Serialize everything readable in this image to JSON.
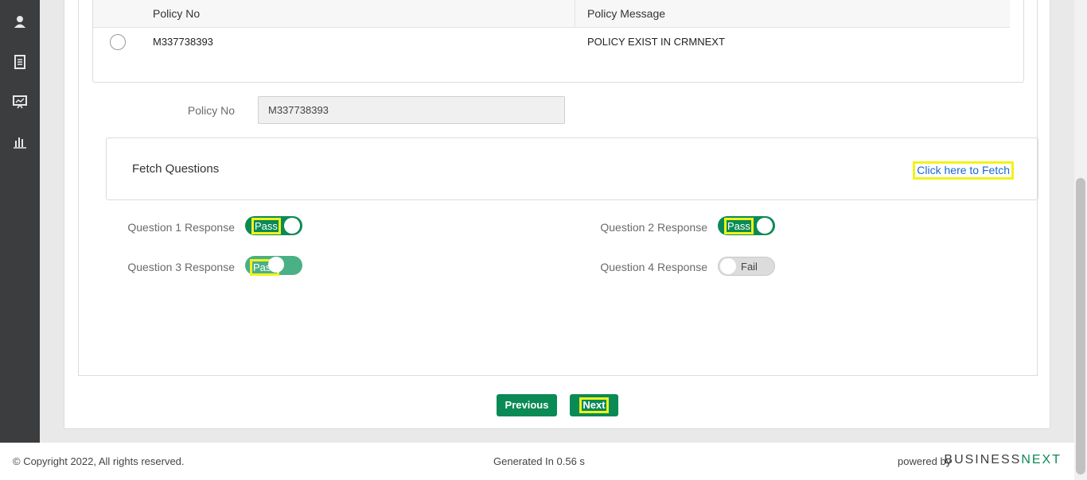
{
  "sidebar": {
    "icons": [
      "user-icon",
      "document-icon",
      "presentation-icon",
      "chart-icon"
    ]
  },
  "grid": {
    "columns": [
      "Policy No",
      "Policy Message"
    ],
    "rows": [
      {
        "policy_no": "M337738393",
        "message": "POLICY EXIST IN CRMNEXT"
      }
    ]
  },
  "policy_field": {
    "label": "Policy No",
    "value": "M337738393"
  },
  "fetch": {
    "title": "Fetch Questions",
    "link": "Click here to Fetch"
  },
  "questions": [
    {
      "label": "Question 1 Response",
      "state": "Pass"
    },
    {
      "label": "Question 2 Response",
      "state": "Pass"
    },
    {
      "label": "Question 3 Response",
      "state": "Pass"
    },
    {
      "label": "Question 4 Response",
      "state": "Fail"
    }
  ],
  "buttons": {
    "previous": "Previous",
    "next": "Next"
  },
  "footer": {
    "copyright": "© Copyright 2022, All rights reserved.",
    "generated": "Generated In 0.56 s",
    "powered_by": "powered by",
    "brand_business": "BUSINESS",
    "brand_next": "NEXT"
  },
  "colors": {
    "accent": "#0a8a55",
    "sidebar": "#3c3d3f",
    "link": "#1a66d6",
    "highlight": "#f2f21a"
  }
}
